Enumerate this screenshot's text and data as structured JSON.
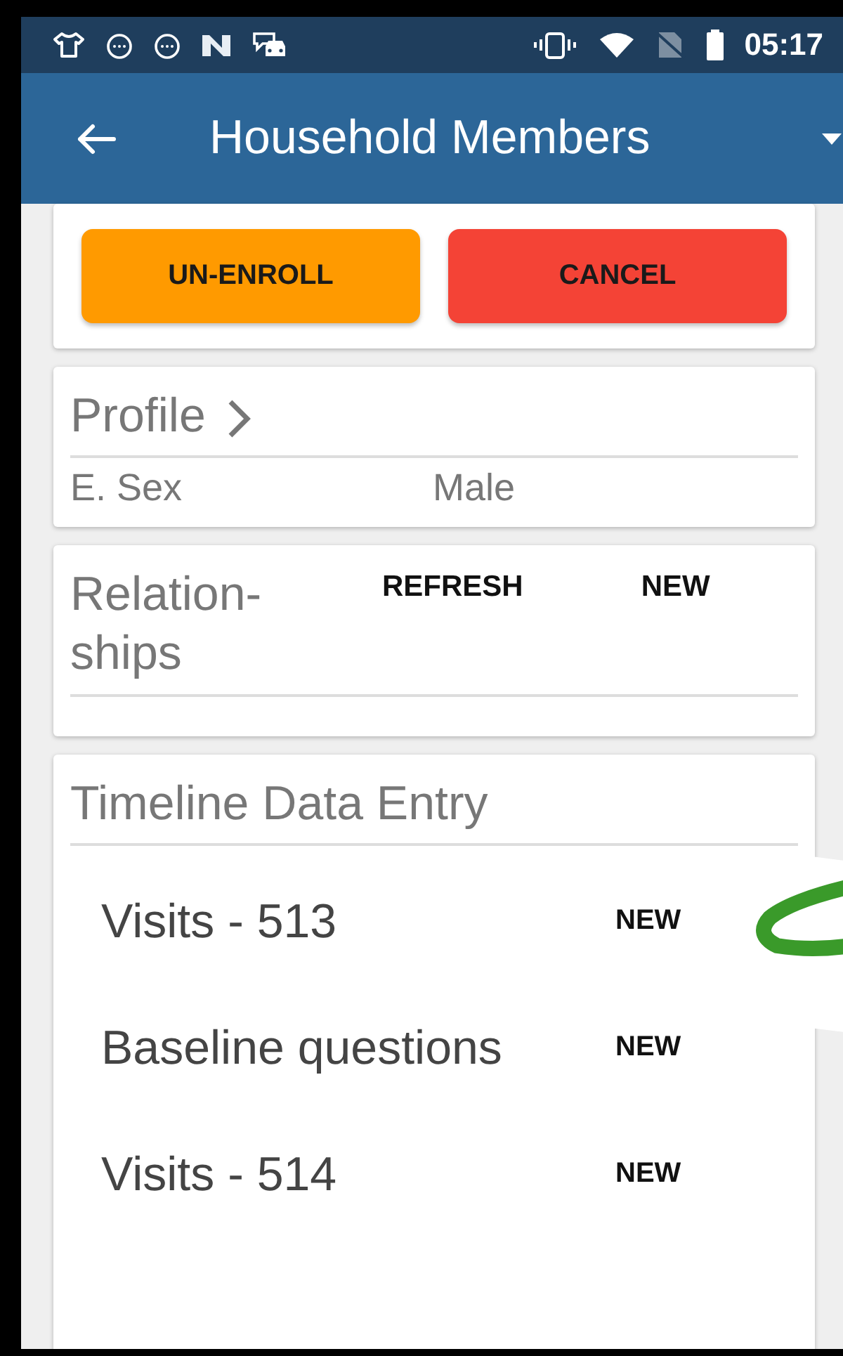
{
  "status_bar": {
    "time": "05:17"
  },
  "app_bar": {
    "title": "Household Members"
  },
  "registration_card": {
    "buttons": [
      {
        "label": "UN-ENROLL",
        "kind": "warning"
      },
      {
        "label": "CANCEL",
        "kind": "danger"
      }
    ]
  },
  "profile": {
    "title": "Profile",
    "fields": [
      {
        "label": "E. Sex",
        "value": "Male"
      }
    ]
  },
  "relationships": {
    "title": "Relation-ships",
    "actions": [
      "REFRESH",
      "NEW"
    ]
  },
  "timeline": {
    "title": "Timeline Data Entry",
    "items": [
      {
        "label": "Visits - 513",
        "action": "NEW"
      },
      {
        "label": "Baseline questions",
        "action": "NEW"
      },
      {
        "label": "Visits - 514",
        "action": "NEW"
      }
    ]
  }
}
